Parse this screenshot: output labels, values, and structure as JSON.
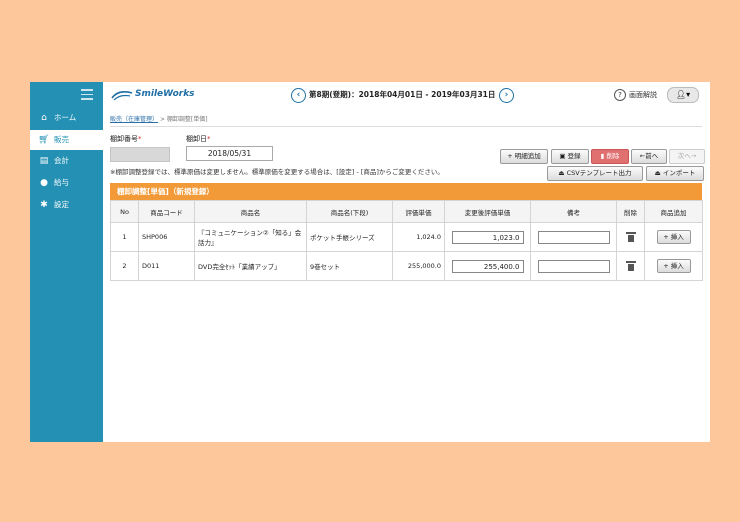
{
  "sidebar": {
    "menu_icon": "hamburger-icon",
    "items": [
      {
        "label": "ホーム",
        "icon": "home-icon"
      },
      {
        "label": "販売",
        "icon": "cart-icon",
        "active": true
      },
      {
        "label": "会計",
        "icon": "ledger-icon"
      },
      {
        "label": "給与",
        "icon": "moneybag-icon"
      },
      {
        "label": "設定",
        "icon": "gear-icon"
      }
    ]
  },
  "header": {
    "logo_text": "SmileWorks",
    "period_text": "第8期(登期)：2018年04月01日 - 2019年03月31日",
    "prev_icon": "‹",
    "next_icon": "›",
    "help_label": "画面解説",
    "user_icon": "user-icon"
  },
  "breadcrumb": {
    "parent": "販売（在庫管理）",
    "sep": ">",
    "current": "棚卸調整[単価]"
  },
  "form": {
    "number_label": "棚卸番号",
    "date_label": "棚卸日",
    "required_mark": "*",
    "date_value": "2018/05/31",
    "note": "※棚卸調整登録では、標準原価は変更しません。標準原価を変更する場合は、[設定] - [商品]からご変更ください。"
  },
  "buttons": {
    "add_detail": "+ 明細追加",
    "register": "登録",
    "delete": "削除",
    "prev": "←前へ",
    "next": "次へ→",
    "csv_template": "CSVテンプレート出力",
    "import": "インポート"
  },
  "section_title": "棚卸調整[単価]（新規登録）",
  "table": {
    "headers": [
      "No",
      "商品コード",
      "商品名",
      "商品名(下段)",
      "評価単価",
      "変更後評価単価",
      "備考",
      "削除",
      "商品追加"
    ],
    "rows": [
      {
        "no": "1",
        "code": "SHP006",
        "name": "『コミュニケーション②「知る」会話力』",
        "sub": "ポケット手帳シリーズ",
        "price": "1,024.0",
        "new_price": "1,023.0",
        "note": "",
        "insert": "+ 挿入"
      },
      {
        "no": "2",
        "code": "D011",
        "name": "DVD完全ｾｯﾄ「業績アップ」",
        "sub": "9巻セット",
        "price": "255,000.0",
        "new_price": "255,400.0",
        "note": "",
        "insert": "+ 挿入"
      }
    ]
  }
}
